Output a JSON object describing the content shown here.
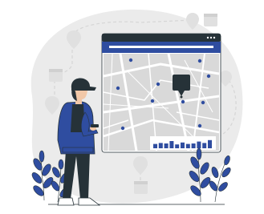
{
  "illustration": {
    "palette": {
      "primary_blue": "#2F4DA0",
      "dark": "#263238",
      "light_gray_blob": "#EBEBEB",
      "map_gray": "#D9D9D9",
      "road_white": "#FFFFFF",
      "ghost_icon_gray": "#E0E0E0",
      "skin": "#F2C8A8"
    },
    "icons": [
      "calendar-icon",
      "location-pin-icon",
      "map-marker-icon",
      "bar-chart-icon",
      "leaf-plant-icon"
    ],
    "bar_chart_levels": [
      0.45,
      0.55,
      0.5,
      0.75,
      0.4,
      0.6,
      0.45,
      0.5,
      0.7,
      0.55,
      0.85
    ]
  }
}
